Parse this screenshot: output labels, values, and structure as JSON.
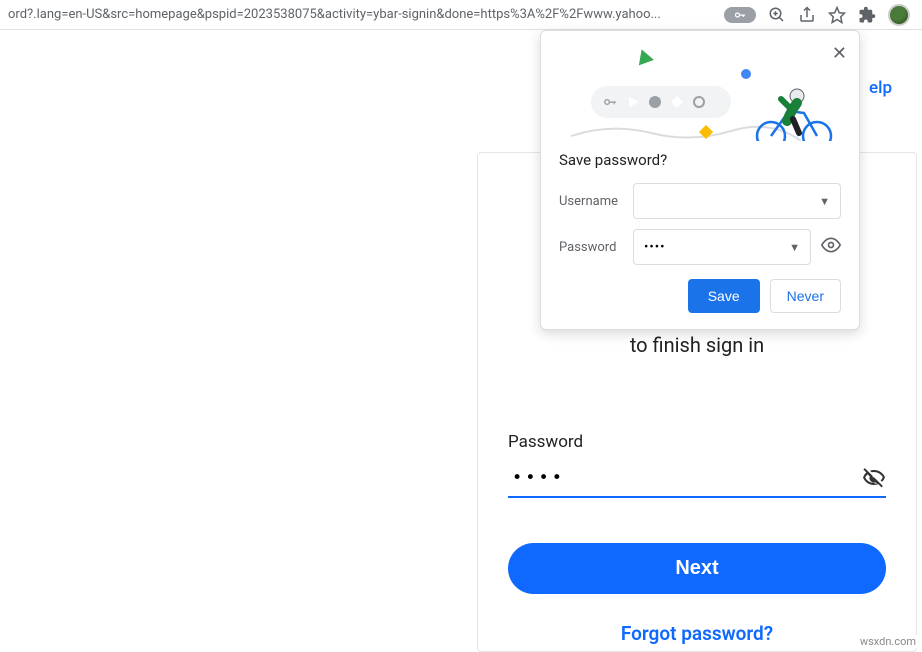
{
  "browser": {
    "url_text": "ord?.lang=en-US&src=homepage&pspid=2023538075&activity=ybar-signin&done=https%3A%2F%2Fwww.yahoo..."
  },
  "header": {
    "help_label": "elp"
  },
  "login": {
    "subtitle": "to finish sign in",
    "password_label": "Password",
    "password_value": "••••",
    "next_label": "Next",
    "forgot_label": "Forgot password?"
  },
  "popup": {
    "title": "Save password?",
    "username_label": "Username",
    "username_value": "",
    "password_label": "Password",
    "password_value": "••••",
    "save_label": "Save",
    "never_label": "Never"
  },
  "watermark": "wsxdn.com"
}
